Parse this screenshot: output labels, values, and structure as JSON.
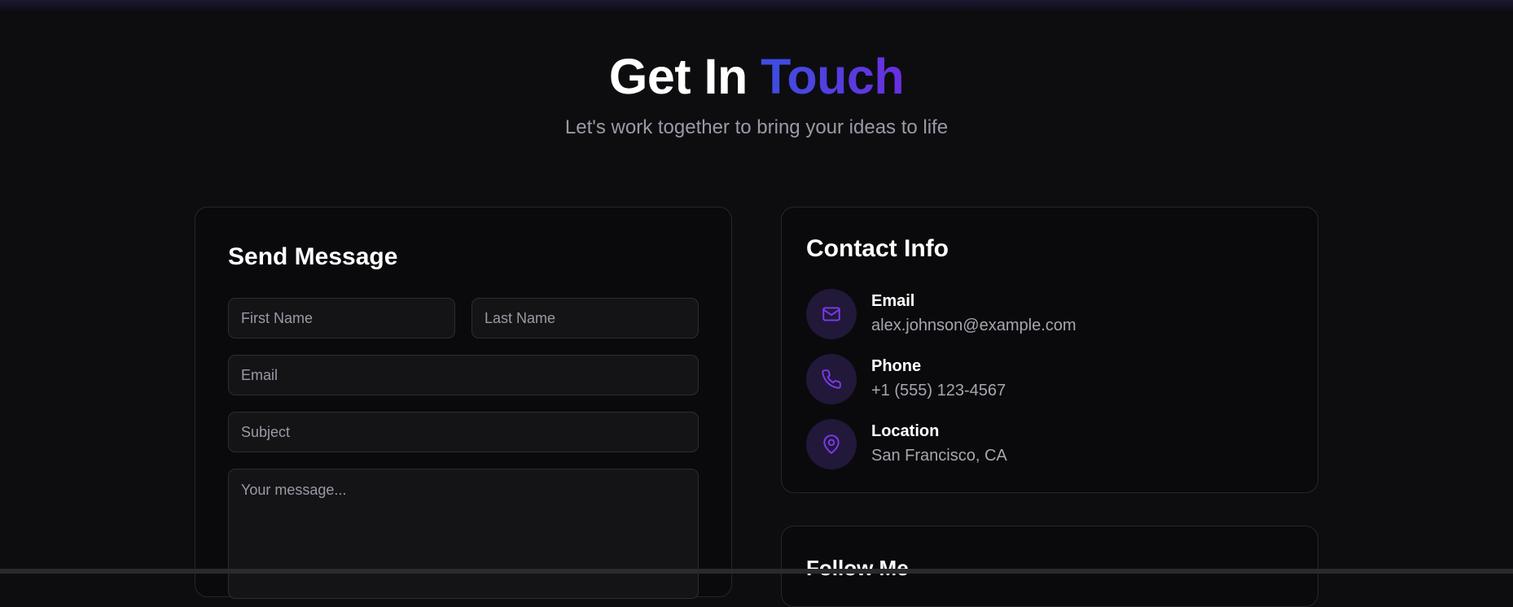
{
  "header": {
    "title_part1": "Get In ",
    "title_accent": "Touch",
    "subtitle": "Let's work together to bring your ideas to life"
  },
  "form": {
    "title": "Send Message",
    "first_name_placeholder": "First Name",
    "last_name_placeholder": "Last Name",
    "email_placeholder": "Email",
    "subject_placeholder": "Subject",
    "message_placeholder": "Your message..."
  },
  "contact": {
    "title": "Contact Info",
    "items": [
      {
        "label": "Email",
        "value": "alex.johnson@example.com",
        "icon": "mail-icon"
      },
      {
        "label": "Phone",
        "value": "+1 (555) 123-4567",
        "icon": "phone-icon"
      },
      {
        "label": "Location",
        "value": "San Francisco, CA",
        "icon": "map-pin-icon"
      }
    ]
  },
  "follow": {
    "title": "Follow Me"
  },
  "colors": {
    "background": "#0d0d10",
    "accent_start": "#3b4fe0",
    "accent_end": "#6a2ee0",
    "icon_color": "#7c3aed",
    "icon_bg": "#22183a"
  }
}
